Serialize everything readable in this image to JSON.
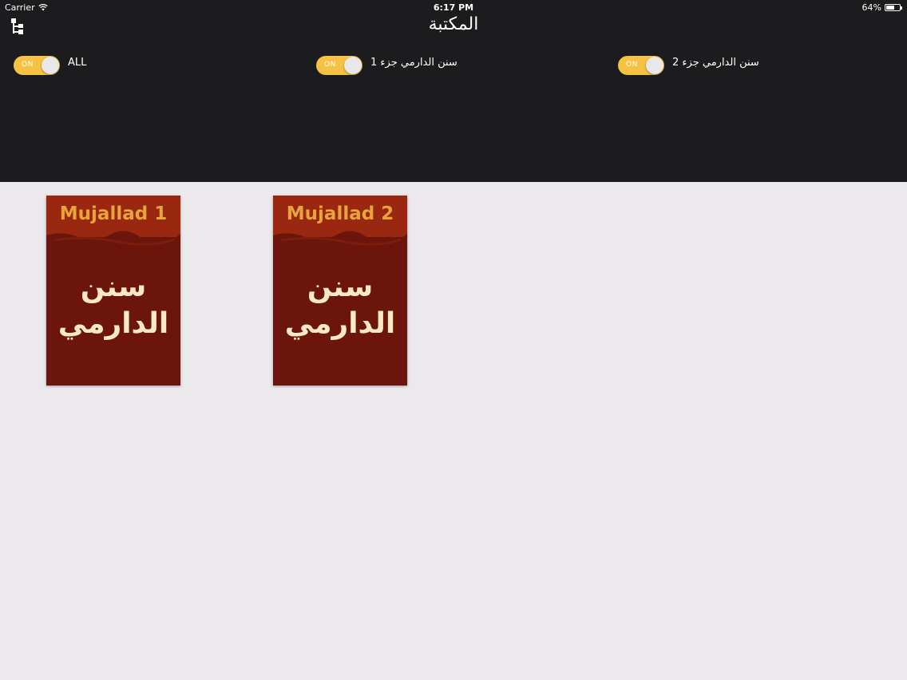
{
  "status_bar": {
    "carrier": "Carrier",
    "time": "6:17 PM",
    "battery": "64%",
    "battery_level": 0.64
  },
  "nav": {
    "title": "المكتبة",
    "menu_icon": "tree-icon"
  },
  "filters": [
    {
      "state": "ON",
      "label": "ALL"
    },
    {
      "state": "ON",
      "label": "سنن الدارمي  جزء 1"
    },
    {
      "state": "ON",
      "label": "سنن الدارمي  جزء 2"
    }
  ],
  "books": [
    {
      "label": "Mujallad 1",
      "title_line1": "سنن",
      "title_line2": "الدارمي"
    },
    {
      "label": "Mujallad 2",
      "title_line1": "سنن",
      "title_line2": "الدارمي"
    }
  ],
  "colors": {
    "header_bg": "#1c1c1e",
    "body_bg": "#ebe9eb",
    "toggle_on": "#f5c242",
    "book_cover": "#6b150c",
    "book_band": "#9a2810",
    "book_label": "#e6a43a",
    "book_title": "#fde9c4"
  }
}
